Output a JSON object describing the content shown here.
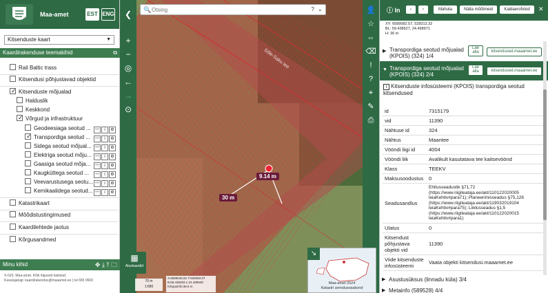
{
  "left": {
    "brand": "Maa-amet",
    "lang_est": "EST",
    "lang_eng": "ENG",
    "map_select": "Kitsenduste kaart",
    "theme_header": "Kaardirakenduse teemakihid",
    "layers": [
      {
        "label": "Rail Baltic trass",
        "checked": false
      },
      {
        "label": "Kitsendusi põhjustavad objektid",
        "checked": false
      },
      {
        "label": "Kitsenduste mõjualad",
        "checked": true
      },
      {
        "label": "Halduslik",
        "checked": false
      },
      {
        "label": "Keskkond",
        "checked": false
      },
      {
        "label": "Võrgud ja infrastruktuur",
        "checked": true
      },
      {
        "label": "Geodeesiaga seotud ...",
        "checked": false
      },
      {
        "label": "Transpordiga seotud ...",
        "checked": true
      },
      {
        "label": "Sidega seotud mõjual...",
        "checked": false
      },
      {
        "label": "Elektriga seotud mõju...",
        "checked": false
      },
      {
        "label": "Gaasiga seotud mõja...",
        "checked": false
      },
      {
        "label": "Kaugküttega seotud ...",
        "checked": false
      },
      {
        "label": "Veevarustusega seotu...",
        "checked": false
      },
      {
        "label": "Kemikaalidega seotud...",
        "checked": false
      },
      {
        "label": "Katastrikaart",
        "checked": false
      },
      {
        "label": "Mõõdistustingimused",
        "checked": false
      },
      {
        "label": "Kaardilehtede jaotus",
        "checked": false
      },
      {
        "label": "Kõrgusandmed",
        "checked": false
      }
    ],
    "my_layers": "Minu kihid",
    "footer_line1": "X-GIS. Maa-amet. Kõik õigused kaitstud.",
    "footer_line2": "Kasutajatugi: kaardirakendus@maaamet.ee | tel 665 0600"
  },
  "map": {
    "search_placeholder": "Otsing",
    "label_distance": "9.14 m",
    "label_width": "30 m",
    "road_name": "Sõle-Saku tee",
    "basemap_label": "Aluskaardid",
    "scale_text": "70 m",
    "scale_ratio": "1:680",
    "coords_line1": "X:6589045.82 Y:528393.07",
    "coords_line2": "B:59.438293 L:24.499949",
    "coords_line3": "Kõrgusinfo:36.5 m",
    "minimap_caption1": "Maa-amet 2024",
    "minimap_caption2": "Katastri arendusosakond"
  },
  "right": {
    "title": "In",
    "btn_mahuta": "Mahuta",
    "btn_naita": "Näita mõõtmeid",
    "btn_kaldaero": "Kaldaerofotod",
    "xy": "XY: 6589082.57, 528313.32",
    "bl": "BL: 59.438627, 24.498971",
    "h": "H: 36 m",
    "acc1_title": "Transpordiga seotud mõjualad (KPOIS) (324) 1/4",
    "acc2_title": "Transpordiga seotud mõjualad (KPOIS) (324) 2/4",
    "btn_lae_alla": "Lae alla",
    "btn_kitsendused": "kitsendused.maaamet.ee",
    "info_title": "Kitsenduste infosüsteemi (KPOIS) transpordiga seotud kitsendused",
    "attributes": [
      {
        "k": "id",
        "v": "7315179"
      },
      {
        "k": "vid",
        "v": "11390"
      },
      {
        "k": "Nähtuse id",
        "v": "324"
      },
      {
        "k": "Nähtus",
        "v": "Maantee"
      },
      {
        "k": "Vööndi liigi id",
        "v": "4004"
      },
      {
        "k": "Vööndi liik",
        "v": "Avalikult kasutatava tee kaitsevöönd"
      },
      {
        "k": "Klass",
        "v": "TEEKV"
      },
      {
        "k": "Maksusoodustus",
        "v": "0"
      },
      {
        "k": "Seadusandlus",
        "v": "Ehitusseadustik §71,72 (https://www.riigiteataja.ee/akt/110122020005 leiaKehtiv#para71); Planeerimisseadus §75,126 (https://www.riigiteataja.ee/akt/119032019104 leiaKehtiv#para75); Liiklusseadus §1,5 (https://www.riigiteataja.ee/akt/110122020015 leiaKehtiv#para1)"
      },
      {
        "k": "Ulatus",
        "v": "0"
      },
      {
        "k": "Kitsendust põhjustava objekti vid",
        "v": "11390"
      },
      {
        "k": "Viide kitsenduste infosüsteemi",
        "v": "Vaata objekti kitsendusi.maaamet.ee"
      }
    ],
    "acc3_title": "Asustusüksus (linnadu küla) 3/4",
    "acc4_title": "Metainfo (589528) 4/4"
  }
}
